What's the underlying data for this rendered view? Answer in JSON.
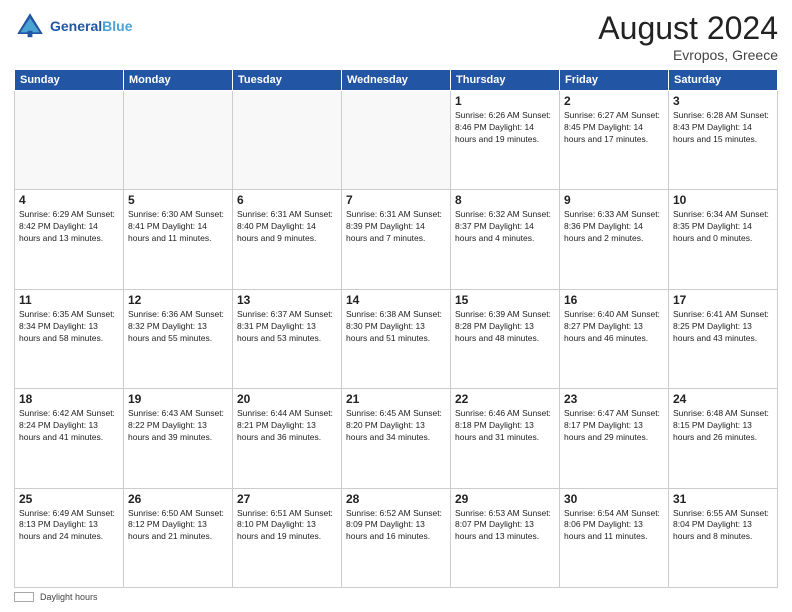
{
  "header": {
    "logo_line1": "General",
    "logo_line2": "Blue",
    "month": "August 2024",
    "location": "Evropos, Greece"
  },
  "weekdays": [
    "Sunday",
    "Monday",
    "Tuesday",
    "Wednesday",
    "Thursday",
    "Friday",
    "Saturday"
  ],
  "weeks": [
    [
      {
        "day": "",
        "info": ""
      },
      {
        "day": "",
        "info": ""
      },
      {
        "day": "",
        "info": ""
      },
      {
        "day": "",
        "info": ""
      },
      {
        "day": "1",
        "info": "Sunrise: 6:26 AM\nSunset: 8:46 PM\nDaylight: 14 hours\nand 19 minutes."
      },
      {
        "day": "2",
        "info": "Sunrise: 6:27 AM\nSunset: 8:45 PM\nDaylight: 14 hours\nand 17 minutes."
      },
      {
        "day": "3",
        "info": "Sunrise: 6:28 AM\nSunset: 8:43 PM\nDaylight: 14 hours\nand 15 minutes."
      }
    ],
    [
      {
        "day": "4",
        "info": "Sunrise: 6:29 AM\nSunset: 8:42 PM\nDaylight: 14 hours\nand 13 minutes."
      },
      {
        "day": "5",
        "info": "Sunrise: 6:30 AM\nSunset: 8:41 PM\nDaylight: 14 hours\nand 11 minutes."
      },
      {
        "day": "6",
        "info": "Sunrise: 6:31 AM\nSunset: 8:40 PM\nDaylight: 14 hours\nand 9 minutes."
      },
      {
        "day": "7",
        "info": "Sunrise: 6:31 AM\nSunset: 8:39 PM\nDaylight: 14 hours\nand 7 minutes."
      },
      {
        "day": "8",
        "info": "Sunrise: 6:32 AM\nSunset: 8:37 PM\nDaylight: 14 hours\nand 4 minutes."
      },
      {
        "day": "9",
        "info": "Sunrise: 6:33 AM\nSunset: 8:36 PM\nDaylight: 14 hours\nand 2 minutes."
      },
      {
        "day": "10",
        "info": "Sunrise: 6:34 AM\nSunset: 8:35 PM\nDaylight: 14 hours\nand 0 minutes."
      }
    ],
    [
      {
        "day": "11",
        "info": "Sunrise: 6:35 AM\nSunset: 8:34 PM\nDaylight: 13 hours\nand 58 minutes."
      },
      {
        "day": "12",
        "info": "Sunrise: 6:36 AM\nSunset: 8:32 PM\nDaylight: 13 hours\nand 55 minutes."
      },
      {
        "day": "13",
        "info": "Sunrise: 6:37 AM\nSunset: 8:31 PM\nDaylight: 13 hours\nand 53 minutes."
      },
      {
        "day": "14",
        "info": "Sunrise: 6:38 AM\nSunset: 8:30 PM\nDaylight: 13 hours\nand 51 minutes."
      },
      {
        "day": "15",
        "info": "Sunrise: 6:39 AM\nSunset: 8:28 PM\nDaylight: 13 hours\nand 48 minutes."
      },
      {
        "day": "16",
        "info": "Sunrise: 6:40 AM\nSunset: 8:27 PM\nDaylight: 13 hours\nand 46 minutes."
      },
      {
        "day": "17",
        "info": "Sunrise: 6:41 AM\nSunset: 8:25 PM\nDaylight: 13 hours\nand 43 minutes."
      }
    ],
    [
      {
        "day": "18",
        "info": "Sunrise: 6:42 AM\nSunset: 8:24 PM\nDaylight: 13 hours\nand 41 minutes."
      },
      {
        "day": "19",
        "info": "Sunrise: 6:43 AM\nSunset: 8:22 PM\nDaylight: 13 hours\nand 39 minutes."
      },
      {
        "day": "20",
        "info": "Sunrise: 6:44 AM\nSunset: 8:21 PM\nDaylight: 13 hours\nand 36 minutes."
      },
      {
        "day": "21",
        "info": "Sunrise: 6:45 AM\nSunset: 8:20 PM\nDaylight: 13 hours\nand 34 minutes."
      },
      {
        "day": "22",
        "info": "Sunrise: 6:46 AM\nSunset: 8:18 PM\nDaylight: 13 hours\nand 31 minutes."
      },
      {
        "day": "23",
        "info": "Sunrise: 6:47 AM\nSunset: 8:17 PM\nDaylight: 13 hours\nand 29 minutes."
      },
      {
        "day": "24",
        "info": "Sunrise: 6:48 AM\nSunset: 8:15 PM\nDaylight: 13 hours\nand 26 minutes."
      }
    ],
    [
      {
        "day": "25",
        "info": "Sunrise: 6:49 AM\nSunset: 8:13 PM\nDaylight: 13 hours\nand 24 minutes."
      },
      {
        "day": "26",
        "info": "Sunrise: 6:50 AM\nSunset: 8:12 PM\nDaylight: 13 hours\nand 21 minutes."
      },
      {
        "day": "27",
        "info": "Sunrise: 6:51 AM\nSunset: 8:10 PM\nDaylight: 13 hours\nand 19 minutes."
      },
      {
        "day": "28",
        "info": "Sunrise: 6:52 AM\nSunset: 8:09 PM\nDaylight: 13 hours\nand 16 minutes."
      },
      {
        "day": "29",
        "info": "Sunrise: 6:53 AM\nSunset: 8:07 PM\nDaylight: 13 hours\nand 13 minutes."
      },
      {
        "day": "30",
        "info": "Sunrise: 6:54 AM\nSunset: 8:06 PM\nDaylight: 13 hours\nand 11 minutes."
      },
      {
        "day": "31",
        "info": "Sunrise: 6:55 AM\nSunset: 8:04 PM\nDaylight: 13 hours\nand 8 minutes."
      }
    ]
  ],
  "footer": {
    "daylight_label": "Daylight hours"
  }
}
